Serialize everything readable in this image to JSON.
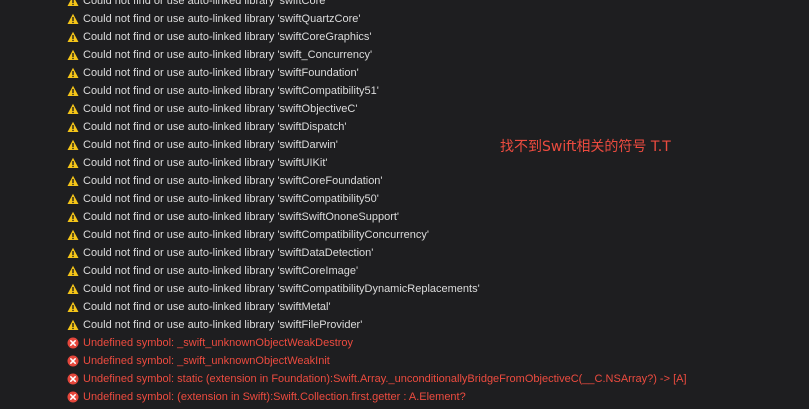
{
  "log": {
    "rows": [
      {
        "type": "warning",
        "icon": "warning-icon",
        "text": "Could not find or use auto-linked library 'swiftCore'"
      },
      {
        "type": "warning",
        "icon": "warning-icon",
        "text": "Could not find or use auto-linked library 'swiftQuartzCore'"
      },
      {
        "type": "warning",
        "icon": "warning-icon",
        "text": "Could not find or use auto-linked library 'swiftCoreGraphics'"
      },
      {
        "type": "warning",
        "icon": "warning-icon",
        "text": "Could not find or use auto-linked library 'swift_Concurrency'"
      },
      {
        "type": "warning",
        "icon": "warning-icon",
        "text": "Could not find or use auto-linked library 'swiftFoundation'"
      },
      {
        "type": "warning",
        "icon": "warning-icon",
        "text": "Could not find or use auto-linked library 'swiftCompatibility51'"
      },
      {
        "type": "warning",
        "icon": "warning-icon",
        "text": "Could not find or use auto-linked library 'swiftObjectiveC'"
      },
      {
        "type": "warning",
        "icon": "warning-icon",
        "text": "Could not find or use auto-linked library 'swiftDispatch'"
      },
      {
        "type": "warning",
        "icon": "warning-icon",
        "text": "Could not find or use auto-linked library 'swiftDarwin'"
      },
      {
        "type": "warning",
        "icon": "warning-icon",
        "text": "Could not find or use auto-linked library 'swiftUIKit'"
      },
      {
        "type": "warning",
        "icon": "warning-icon",
        "text": "Could not find or use auto-linked library 'swiftCoreFoundation'"
      },
      {
        "type": "warning",
        "icon": "warning-icon",
        "text": "Could not find or use auto-linked library 'swiftCompatibility50'"
      },
      {
        "type": "warning",
        "icon": "warning-icon",
        "text": "Could not find or use auto-linked library 'swiftSwiftOnoneSupport'"
      },
      {
        "type": "warning",
        "icon": "warning-icon",
        "text": "Could not find or use auto-linked library 'swiftCompatibilityConcurrency'"
      },
      {
        "type": "warning",
        "icon": "warning-icon",
        "text": "Could not find or use auto-linked library 'swiftDataDetection'"
      },
      {
        "type": "warning",
        "icon": "warning-icon",
        "text": "Could not find or use auto-linked library 'swiftCoreImage'"
      },
      {
        "type": "warning",
        "icon": "warning-icon",
        "text": "Could not find or use auto-linked library 'swiftCompatibilityDynamicReplacements'"
      },
      {
        "type": "warning",
        "icon": "warning-icon",
        "text": "Could not find or use auto-linked library 'swiftMetal'"
      },
      {
        "type": "warning",
        "icon": "warning-icon",
        "text": "Could not find or use auto-linked library 'swiftFileProvider'"
      },
      {
        "type": "error",
        "icon": "error-icon",
        "text": "Undefined symbol: _swift_unknownObjectWeakDestroy"
      },
      {
        "type": "error",
        "icon": "error-icon",
        "text": "Undefined symbol: _swift_unknownObjectWeakInit"
      },
      {
        "type": "error",
        "icon": "error-icon",
        "text": "Undefined symbol: static (extension in Foundation):Swift.Array._unconditionallyBridgeFromObjectiveC(__C.NSArray?) -> [A]"
      },
      {
        "type": "error",
        "icon": "error-icon",
        "text": "Undefined symbol: (extension in Swift):Swift.Collection.first.getter : A.Element?"
      }
    ]
  },
  "annotation": {
    "text": "找不到Swift相关的符号 T.T",
    "color": "#ec4b3f"
  },
  "colors": {
    "background": "#1e1e20",
    "warning_icon": "#f5c518",
    "error_icon": "#e5473c",
    "warning_text": "#dcdcdc",
    "error_text": "#ec4b3f"
  }
}
